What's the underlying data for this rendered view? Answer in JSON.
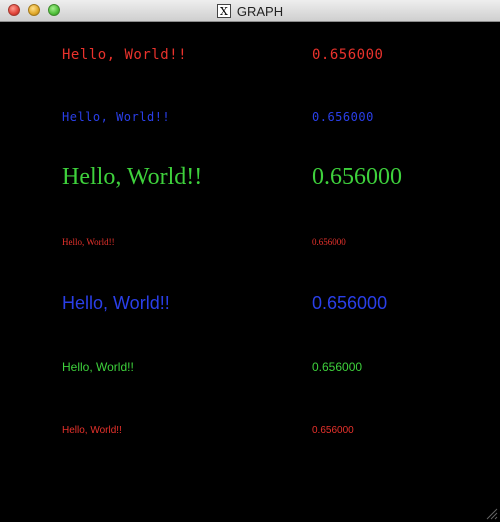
{
  "window": {
    "title": "GRAPH",
    "app_icon": "x11-icon",
    "app_icon_glyph": "X"
  },
  "colors": {
    "background": "#000000",
    "red": "#e8322c",
    "blue": "#2a3fe8",
    "green": "#3ed13c"
  },
  "rows": [
    {
      "text": "Hello, World!!",
      "value": "0.656000",
      "color": "red"
    },
    {
      "text": "Hello, World!!",
      "value": "0.656000",
      "color": "blue"
    },
    {
      "text": "Hello, World!!",
      "value": "0.656000",
      "color": "green"
    },
    {
      "text": "Hello, World!!",
      "value": "0.656000",
      "color": "red"
    },
    {
      "text": "Hello, World!!",
      "value": "0.656000",
      "color": "blue"
    },
    {
      "text": "Hello, World!!",
      "value": "0.656000",
      "color": "green"
    },
    {
      "text": "Hello, World!!",
      "value": "0.656000",
      "color": "red"
    }
  ]
}
